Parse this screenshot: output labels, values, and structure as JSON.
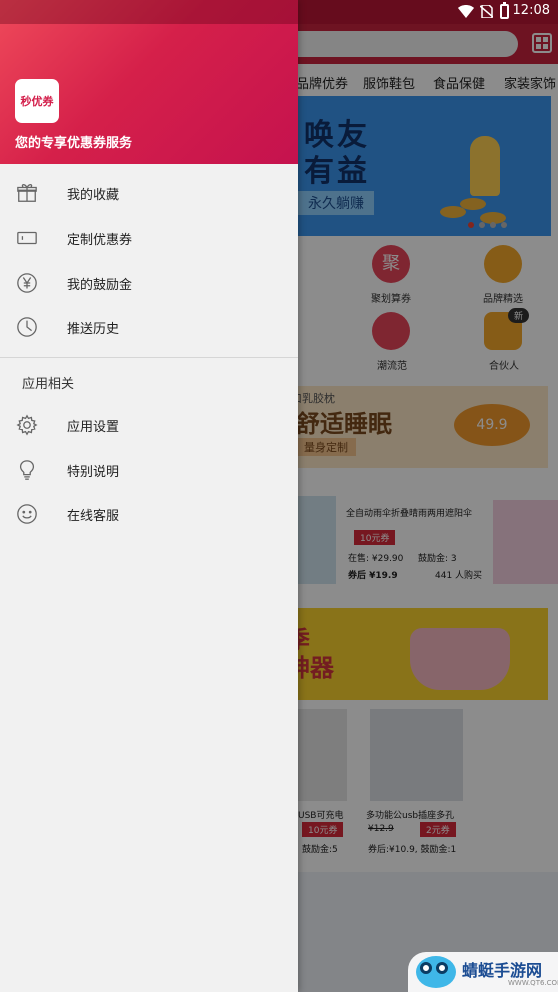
{
  "status_bar": {
    "time": "12:08"
  },
  "drawer": {
    "logo_text": "秒优券",
    "tagline": "您的专享优惠券服务",
    "menu_items": [
      {
        "label": "我的收藏",
        "icon": "gift-icon"
      },
      {
        "label": "定制优惠券",
        "icon": "ticket-icon"
      },
      {
        "label": "我的鼓励金",
        "icon": "yen-coin-icon"
      },
      {
        "label": "推送历史",
        "icon": "clock-icon"
      }
    ],
    "section_title": "应用相关",
    "app_items": [
      {
        "label": "应用设置",
        "icon": "gear-icon"
      },
      {
        "label": "特别说明",
        "icon": "lightbulb-icon"
      },
      {
        "label": "在线客服",
        "icon": "smiley-icon"
      }
    ]
  },
  "background": {
    "categories": [
      "品牌优券",
      "服饰鞋包",
      "食品保健",
      "家装家饰"
    ],
    "banner1": {
      "title_line1": "唤友",
      "title_line2": "有益",
      "subtitle": "永久躺赚"
    },
    "icons": [
      {
        "label": "聚划算券",
        "glyph": "聚",
        "color": "#e8455a"
      },
      {
        "label": "品牌精选",
        "glyph": "",
        "color": "#f5a82a"
      },
      {
        "label": "潮流范",
        "glyph": "",
        "color": "#e8455a"
      },
      {
        "label": "合伙人",
        "glyph": "新",
        "color": "#f5a82a"
      }
    ],
    "banner2": {
      "top": "进口乳胶枕",
      "title": "舒适睡眠",
      "sub": "量身定制",
      "price": "49.9"
    },
    "product": {
      "title": "全自动雨伞折叠晴雨两用遮阳伞",
      "coupon": "10元券",
      "on_sale": "在售: ¥29.90",
      "bonus": "鼓励金: 3",
      "after": "券后 ¥19.9",
      "buyers": "441 人购买"
    },
    "banner3": {
      "line1": "季",
      "line2": "神器"
    },
    "grid_products": [
      {
        "title": "USB可充电",
        "coupon": "10元券",
        "bonus": "鼓励金:5"
      },
      {
        "title": "多功能公usb插座多孔",
        "old_price": "¥12.9",
        "coupon": "2元券",
        "after": "券后:¥10.9, 鼓励金:1"
      }
    ]
  },
  "watermark": {
    "title": "蜻蜓手游网",
    "url": "WWW.QT6.COM"
  }
}
